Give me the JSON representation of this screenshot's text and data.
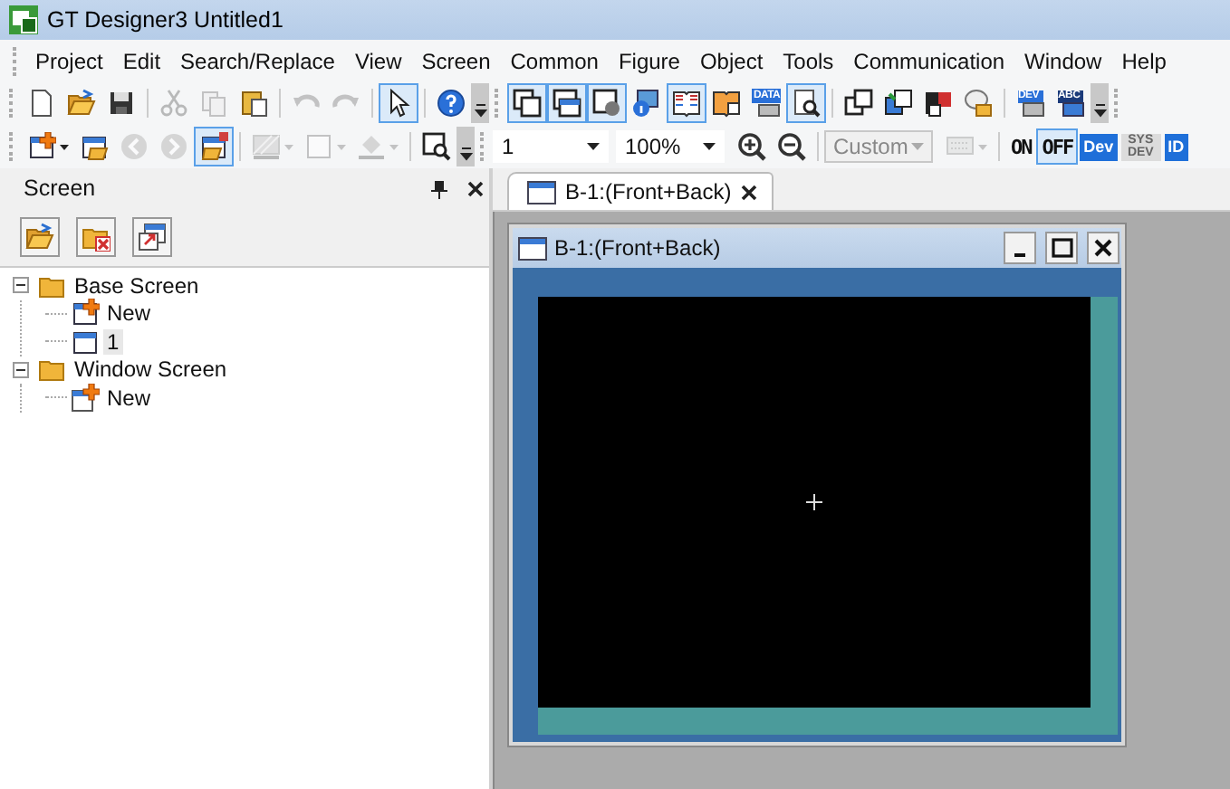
{
  "window": {
    "title": "GT Designer3 Untitled1"
  },
  "menu": [
    "Project",
    "Edit",
    "Search/Replace",
    "View",
    "Screen",
    "Common",
    "Figure",
    "Object",
    "Tools",
    "Communication",
    "Window",
    "Help"
  ],
  "toolbars": [
    {
      "items": [
        {
          "kind": "icon",
          "pressed": false,
          "disabled": false
        },
        {
          "kind": "icon",
          "pressed": false,
          "disabled": false
        },
        {
          "kind": "icon",
          "pressed": false,
          "disabled": false
        },
        {
          "kind": "separator"
        },
        {
          "kind": "icon",
          "pressed": false,
          "disabled": true
        },
        {
          "kind": "icon",
          "pressed": false,
          "disabled": true
        },
        {
          "kind": "icon",
          "pressed": false,
          "disabled": false
        },
        {
          "kind": "separator"
        },
        {
          "kind": "icon",
          "pressed": false,
          "disabled": true
        },
        {
          "kind": "icon",
          "pressed": false,
          "disabled": true
        },
        {
          "kind": "separator"
        },
        {
          "kind": "icon",
          "pressed": true,
          "disabled": false
        },
        {
          "kind": "separator"
        },
        {
          "kind": "icon",
          "pressed": false,
          "disabled": false
        },
        {
          "kind": "overflow"
        },
        {
          "kind": "icon",
          "pressed": true,
          "disabled": false
        },
        {
          "kind": "icon",
          "pressed": true,
          "disabled": false
        },
        {
          "kind": "icon",
          "pressed": true,
          "disabled": false
        },
        {
          "kind": "icon",
          "pressed": false,
          "disabled": false
        },
        {
          "kind": "icon",
          "pressed": true,
          "disabled": false
        },
        {
          "kind": "icon",
          "pressed": false,
          "disabled": false
        },
        {
          "kind": "icon",
          "pressed": false,
          "disabled": false,
          "label": "DATA"
        },
        {
          "kind": "icon",
          "pressed": true,
          "disabled": false
        },
        {
          "kind": "separator"
        },
        {
          "kind": "icon",
          "pressed": false,
          "disabled": false
        },
        {
          "kind": "icon",
          "pressed": false,
          "disabled": false
        },
        {
          "kind": "icon",
          "pressed": false,
          "disabled": false
        },
        {
          "kind": "icon",
          "pressed": false,
          "disabled": false
        },
        {
          "kind": "separator"
        },
        {
          "kind": "icon",
          "pressed": false,
          "disabled": false,
          "label": "DEV"
        },
        {
          "kind": "icon",
          "pressed": false,
          "disabled": false,
          "label": "ABC"
        },
        {
          "kind": "overflow"
        }
      ]
    },
    {
      "items": [
        {
          "kind": "icon",
          "pressed": false,
          "disabled": false,
          "dropdown": true
        },
        {
          "kind": "icon",
          "pressed": false,
          "disabled": false
        },
        {
          "kind": "icon",
          "pressed": false,
          "disabled": true
        },
        {
          "kind": "icon",
          "pressed": false,
          "disabled": true
        },
        {
          "kind": "icon",
          "pressed": true,
          "disabled": false
        },
        {
          "kind": "separator"
        },
        {
          "kind": "icon",
          "pressed": false,
          "disabled": true,
          "dropdown": true
        },
        {
          "kind": "icon",
          "pressed": false,
          "disabled": true,
          "dropdown": true
        },
        {
          "kind": "icon",
          "pressed": false,
          "disabled": true,
          "dropdown": true
        },
        {
          "kind": "separator"
        },
        {
          "kind": "icon",
          "pressed": false,
          "disabled": false
        },
        {
          "kind": "overflow"
        },
        {
          "kind": "combo",
          "value": "1",
          "disabled": false
        },
        {
          "kind": "combo",
          "value": "100%",
          "disabled": false
        },
        {
          "kind": "icon",
          "pressed": false,
          "disabled": false
        },
        {
          "kind": "icon",
          "pressed": false,
          "disabled": false
        },
        {
          "kind": "separator"
        },
        {
          "kind": "combo",
          "value": "Custom",
          "disabled": true
        },
        {
          "kind": "icon",
          "pressed": false,
          "disabled": true,
          "dropdown": true
        },
        {
          "kind": "separator"
        },
        {
          "kind": "text",
          "label": "ON",
          "pressed": false,
          "disabled": false
        },
        {
          "kind": "text",
          "label": "OFF",
          "pressed": true,
          "disabled": false
        },
        {
          "kind": "badge",
          "label": "Dev",
          "disabled": false
        },
        {
          "kind": "badge",
          "label": "SYS DEV",
          "disabled": true
        },
        {
          "kind": "badge",
          "label": "ID",
          "disabled": false
        }
      ]
    }
  ],
  "screen_panel": {
    "title": "Screen",
    "tools": [
      {
        "kind": "open-folder"
      },
      {
        "kind": "delete-folder"
      },
      {
        "kind": "new-window"
      }
    ],
    "tree": [
      {
        "label": "Base Screen",
        "kind": "folder",
        "expanded": true,
        "selected": false,
        "children": [
          {
            "label": "New",
            "kind": "new",
            "selected": false
          },
          {
            "label": "1",
            "kind": "screen",
            "selected": true
          }
        ]
      },
      {
        "label": "Window Screen",
        "kind": "folder",
        "expanded": true,
        "selected": false,
        "children": [
          {
            "label": "New",
            "kind": "new-window",
            "selected": false
          }
        ]
      }
    ]
  },
  "document_tabs": [
    {
      "label": "B-1:(Front+Back)",
      "selected": true
    }
  ],
  "editor_window": {
    "title": "B-1:(Front+Back)"
  }
}
